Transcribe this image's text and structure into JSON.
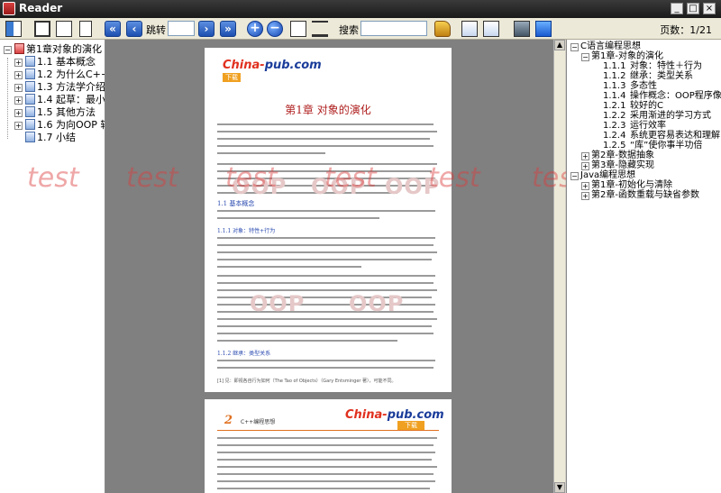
{
  "window": {
    "title": "Reader",
    "controls": [
      "_",
      "□",
      "×"
    ]
  },
  "toolbar": {
    "jump_label": "跳转",
    "jump_value": "",
    "search_label": "搜索",
    "search_value": "",
    "page_count": "页数：1/21"
  },
  "left_tree": {
    "items": [
      {
        "label": "第1章对象的演化",
        "expander": "−"
      },
      {
        "label": "1.1 基本概念",
        "expander": "+"
      },
      {
        "label": "1.2 为什么C++",
        "expander": "+"
      },
      {
        "label": "1.3 方法学介绍",
        "expander": "+"
      },
      {
        "label": "1.4 起草：最小",
        "expander": "+"
      },
      {
        "label": "1.5 其他方法",
        "expander": "+"
      },
      {
        "label": "1.6 为向OOP 转",
        "expander": "+"
      },
      {
        "label": "1.7 小结",
        "expander": ""
      }
    ]
  },
  "document": {
    "page1": {
      "logo_part1": "China-",
      "logo_part2": "pub.com",
      "badge": "下载",
      "chapter_title": "第1章   对象的演化",
      "section_1_1": "1.1   基本概念",
      "section_1_1_1": "1.1.1   对象：特性+行为",
      "section_1_1_2": "1.1.2   继承：类型关系",
      "watermark_text": "OOP",
      "footnote": "[1] 见：即视各自行为如何（The Tao of Objects）（Gary Entsminger 著），可能不同。"
    },
    "page2": {
      "page_number": "2",
      "header": "C++编程思想",
      "logo_part1": "China-",
      "logo_part2": "pub.com",
      "badge": "下载"
    }
  },
  "overlay": {
    "watermark": "test"
  },
  "right_tree": {
    "items": [
      {
        "text": "C语言编程思想",
        "num": "",
        "expander": "−",
        "level": 0
      },
      {
        "text": "第1章-对象的演化",
        "num": "",
        "expander": "−",
        "level": 1
      },
      {
        "text": "对象：特性＋行为",
        "num": "1.1.1",
        "expander": "",
        "level": 2
      },
      {
        "text": "继承：类型关系",
        "num": "1.1.2",
        "expander": "",
        "level": 2
      },
      {
        "text": "多态性",
        "num": "1.1.3",
        "expander": "",
        "level": 2
      },
      {
        "text": "操作概念：OOP程序像什么",
        "num": "1.1.4",
        "expander": "",
        "level": 2
      },
      {
        "text": "较好的C",
        "num": "1.2.1",
        "expander": "",
        "level": 2
      },
      {
        "text": "采用渐进的学习方式",
        "num": "1.2.2",
        "expander": "",
        "level": 2
      },
      {
        "text": "运行效率",
        "num": "1.2.3",
        "expander": "",
        "level": 2
      },
      {
        "text": "系统更容易表达和理解",
        "num": "1.2.4",
        "expander": "",
        "level": 2
      },
      {
        "text": "“库”使你事半功倍",
        "num": "1.2.5",
        "expander": "",
        "level": 2
      },
      {
        "text": "第2章-数据抽象",
        "num": "",
        "expander": "+",
        "level": 1
      },
      {
        "text": "第3章-隐藏实现",
        "num": "",
        "expander": "+",
        "level": 1
      },
      {
        "text": "Java编程思想",
        "num": "",
        "expander": "−",
        "level": 0
      },
      {
        "text": "第1章-初始化与清除",
        "num": "",
        "expander": "+",
        "level": 1
      },
      {
        "text": "第2章-函数重载与缺省参数",
        "num": "",
        "expander": "+",
        "level": 1
      }
    ]
  }
}
